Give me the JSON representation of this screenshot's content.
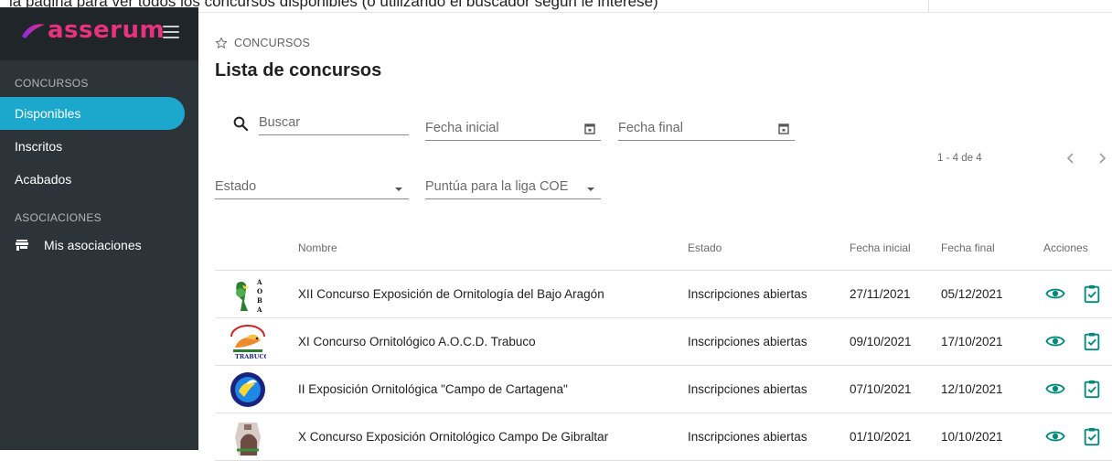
{
  "top_strip": {
    "clipped_text": "la página para ver todos los concursos disponibles (o utilizando el buscador según le interese)"
  },
  "sidebar": {
    "logo_text": "asserum",
    "sections": [
      {
        "title": "CONCURSOS",
        "items": [
          "Disponibles",
          "Inscritos",
          "Acabados"
        ],
        "active": "Disponibles"
      },
      {
        "title": "ASOCIACIONES",
        "items": [
          "Mis asociaciones"
        ]
      }
    ]
  },
  "breadcrumb": "CONCURSOS",
  "page_title": "Lista de concursos",
  "filters": {
    "search_placeholder": "Buscar",
    "fecha_inicial": "Fecha inicial",
    "fecha_final": "Fecha final",
    "estado": "Estado",
    "liga": "Puntúa para la liga COE"
  },
  "pagination": {
    "range": "1 - 4 de 4"
  },
  "table": {
    "headers": [
      "Nombre",
      "Estado",
      "Fecha inicial",
      "Fecha final",
      "Acciones"
    ],
    "rows": [
      {
        "nombre": "XII Concurso Exposición de Ornitología del Bajo Aragón",
        "estado": "Inscripciones abiertas",
        "fecha_inicial": "27/11/2021",
        "fecha_final": "05/12/2021",
        "logo": "aoba-logo"
      },
      {
        "nombre": "XI Concurso Ornitológico A.O.C.D. Trabuco",
        "estado": "Inscripciones abiertas",
        "fecha_inicial": "09/10/2021",
        "fecha_final": "17/10/2021",
        "logo": "trabuco-logo"
      },
      {
        "nombre": "II Exposición Ornitológica \"Campo de Cartagena\"",
        "estado": "Inscripciones abiertas",
        "fecha_inicial": "07/10/2021",
        "fecha_final": "12/10/2021",
        "logo": "cartagena-logo"
      },
      {
        "nombre": "X Concurso Exposición Ornitológico Campo De Gibraltar",
        "estado": "Inscripciones abiertas",
        "fecha_inicial": "01/10/2021",
        "fecha_final": "10/10/2021",
        "logo": "gibraltar-logo"
      }
    ]
  },
  "colors": {
    "accent": "#1ba8cc",
    "brand": "#e8317f",
    "sidebar_bg": "#2c3339",
    "action_icon": "#00897b"
  }
}
